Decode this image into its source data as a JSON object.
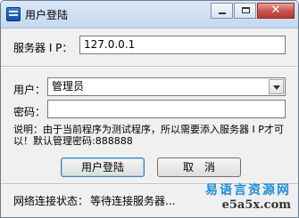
{
  "window": {
    "title": "用户登陆"
  },
  "form": {
    "server_label": "服务器 I P：",
    "server_value": "127.0.0.1",
    "user_label": "用户：",
    "user_value": "管理员",
    "password_label": "密码：",
    "password_value": ""
  },
  "note": "说明：由于当前程序为测试程序，所以需要添入服务器 I P才可以！默认管理密码:888888",
  "buttons": {
    "login": "用户登陆",
    "cancel": "取　消"
  },
  "status": {
    "label": "网络连接状态：",
    "value": "等待连接服务器..."
  },
  "watermark": {
    "cn": "易语言资源网",
    "url": "e5a5x.com"
  }
}
